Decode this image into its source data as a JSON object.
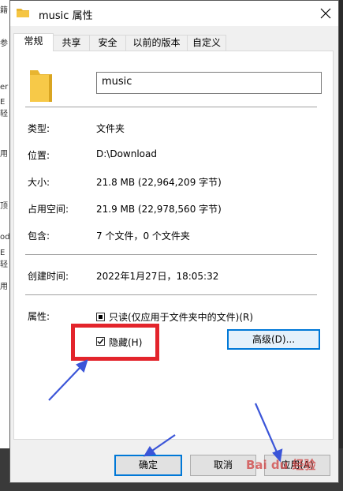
{
  "window": {
    "title": "music 属性",
    "close_glyph": "✕"
  },
  "tabs": [
    {
      "label": "常规",
      "active": true
    },
    {
      "label": "共享",
      "active": false
    },
    {
      "label": "安全",
      "active": false
    },
    {
      "label": "以前的版本",
      "active": false
    },
    {
      "label": "自定义",
      "active": false
    }
  ],
  "name_field": {
    "value": "music"
  },
  "properties": [
    {
      "label": "类型:",
      "value": "文件夹"
    },
    {
      "label": "位置:",
      "value": "D:\\Download"
    },
    {
      "label": "大小:",
      "value": "21.8 MB (22,964,209 字节)"
    },
    {
      "label": "占用空间:",
      "value": "21.9 MB (22,978,560 字节)"
    },
    {
      "label": "包含:",
      "value": "7 个文件，0 个文件夹"
    }
  ],
  "created": {
    "label": "创建时间:",
    "value": "2022年1月27日，18:05:32"
  },
  "attributes": {
    "label": "属性:",
    "readonly": {
      "label": "只读(仅应用于文件夹中的文件)(R)",
      "state": "indeterminate"
    },
    "hidden": {
      "label": "隐藏(H)",
      "checked": true
    },
    "advanced_label": "高级(D)..."
  },
  "buttons": {
    "ok": "确定",
    "cancel": "取消",
    "apply": "应用(A)"
  },
  "background_fragments": [
    "籍",
    "参",
    "er",
    "E轻",
    "用",
    "顶",
    "od",
    "E轻",
    "用"
  ],
  "watermark": "Bai du 经验",
  "colors": {
    "accent": "#0078d7",
    "highlight_box": "#e3242b",
    "arrow": "#3b55d8",
    "folder": "#f5c542"
  }
}
